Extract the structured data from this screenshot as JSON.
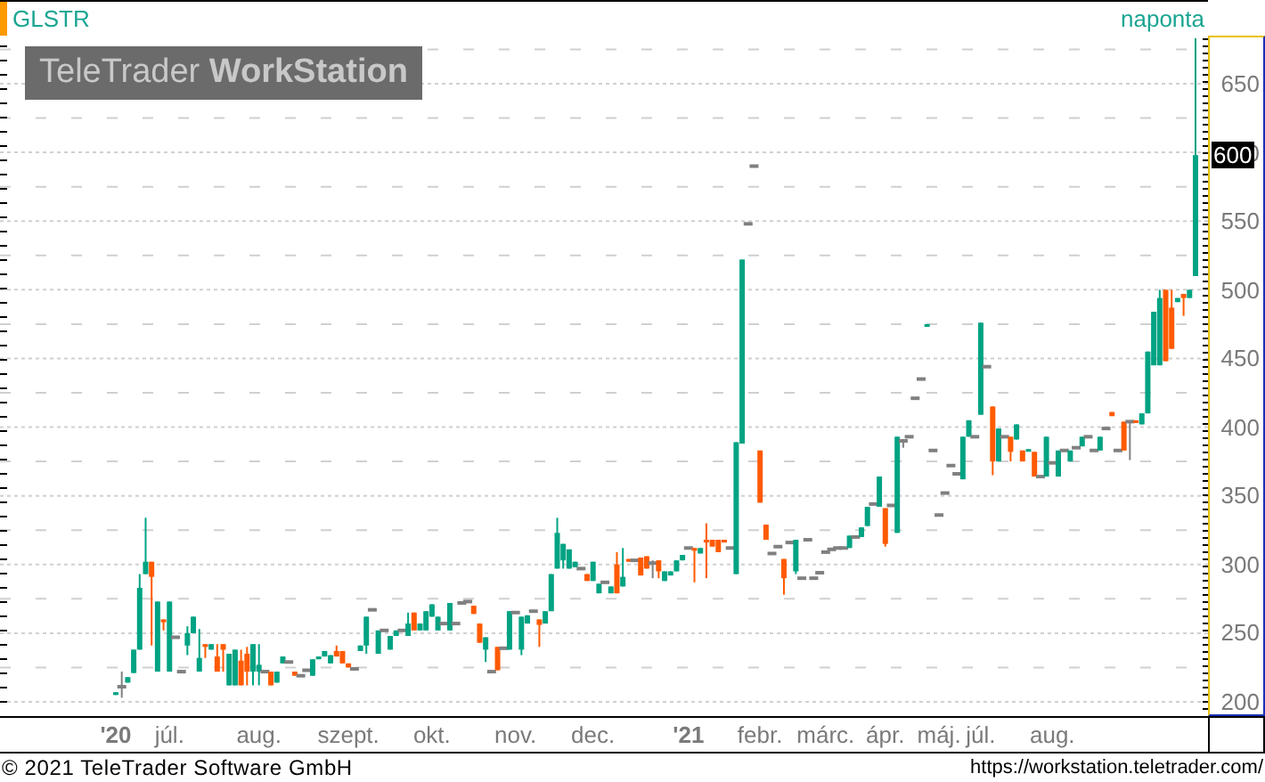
{
  "header": {
    "symbol": "GLSTR",
    "interval": "naponta"
  },
  "logo": "TeleTrader **WorkStation**",
  "price_marker": "600",
  "chart_data": {
    "type": "candlestick",
    "grid": true,
    "ylim": [
      200,
      650
    ],
    "yticks": [
      200,
      250,
      300,
      350,
      400,
      450,
      500,
      550,
      600,
      650
    ],
    "categories": [
      "'20",
      null,
      null,
      null,
      null,
      null,
      null,
      null,
      null,
      "júl.",
      null,
      null,
      null,
      null,
      null,
      null,
      null,
      null,
      null,
      null,
      null,
      null,
      null,
      null,
      "aug.",
      null,
      null,
      null,
      null,
      null,
      null,
      null,
      null,
      null,
      null,
      null,
      null,
      null,
      null,
      "szept.",
      null,
      null,
      null,
      null,
      null,
      null,
      null,
      null,
      null,
      null,
      null,
      null,
      null,
      "okt.",
      null,
      null,
      null,
      null,
      null,
      null,
      null,
      null,
      null,
      null,
      null,
      null,
      null,
      "nov.",
      null,
      null,
      null,
      null,
      null,
      null,
      null,
      null,
      null,
      null,
      null,
      null,
      "dec.",
      null,
      null,
      null,
      null,
      null,
      null,
      null,
      null,
      null,
      null,
      null,
      null,
      null,
      null,
      null,
      "'21",
      null,
      null,
      null,
      null,
      null,
      null,
      null,
      null,
      null,
      null,
      null,
      "febr.",
      null,
      null,
      null,
      null,
      null,
      null,
      null,
      null,
      null,
      null,
      "márc.",
      null,
      null,
      null,
      null,
      null,
      null,
      null,
      null,
      null,
      "ápr.",
      null,
      null,
      null,
      null,
      null,
      null,
      null,
      null,
      "máj.",
      null,
      null,
      null,
      null,
      null,
      null,
      "júl.",
      null,
      null,
      null,
      null,
      null,
      null,
      null,
      null,
      null,
      null,
      null,
      "aug.",
      null,
      null,
      null,
      null,
      null,
      null,
      null,
      null,
      null,
      null,
      null,
      null,
      null,
      null,
      null,
      null,
      null,
      null,
      null,
      null,
      null,
      null,
      null,
      null
    ],
    "ohlc": [
      [
        205,
        207,
        205,
        207
      ],
      [
        211,
        222,
        203,
        211
      ],
      [
        214,
        218,
        214,
        218
      ],
      [
        221,
        238,
        221,
        238
      ],
      [
        238,
        293,
        238,
        283
      ],
      [
        293,
        334,
        293,
        302
      ],
      [
        302,
        302,
        241,
        291
      ],
      [
        222,
        273,
        222,
        273
      ],
      [
        260,
        260,
        252,
        258
      ],
      [
        222,
        273,
        222,
        273
      ],
      [
        247,
        247,
        247,
        247
      ],
      [
        222,
        222,
        222,
        222
      ],
      [
        241,
        255,
        234,
        250
      ],
      [
        250,
        262,
        250,
        262
      ],
      [
        222,
        253,
        222,
        232
      ],
      [
        242,
        242,
        232,
        241
      ],
      [
        238,
        242,
        238,
        242
      ],
      [
        233,
        242,
        222,
        222
      ],
      [
        242,
        242,
        222,
        238
      ],
      [
        212,
        235,
        212,
        235
      ],
      [
        212,
        238,
        212,
        238
      ],
      [
        230,
        238,
        212,
        212
      ],
      [
        235,
        240,
        212,
        222
      ],
      [
        222,
        242,
        212,
        242
      ],
      [
        222,
        242,
        212,
        227
      ],
      [
        222,
        222,
        222,
        222
      ],
      [
        222,
        222,
        212,
        212
      ],
      [
        214,
        222,
        214,
        222
      ],
      [
        228,
        233,
        228,
        233
      ],
      [
        229,
        229,
        229,
        229
      ],
      [
        222,
        222,
        219,
        219
      ],
      [
        219,
        219,
        219,
        219
      ],
      [
        223,
        223,
        223,
        223
      ],
      [
        219,
        231,
        219,
        231
      ],
      [
        231,
        233,
        231,
        233
      ],
      [
        233,
        237,
        233,
        237
      ],
      [
        228,
        234,
        228,
        234
      ],
      [
        237,
        241,
        233,
        233
      ],
      [
        237,
        237,
        228,
        228
      ],
      [
        228,
        228,
        225,
        225
      ],
      [
        224,
        224,
        224,
        224
      ],
      [
        237,
        241,
        237,
        241
      ],
      [
        241,
        262,
        235,
        262
      ],
      [
        267,
        267,
        267,
        267
      ],
      [
        235,
        252,
        235,
        252
      ],
      [
        252,
        252,
        252,
        252
      ],
      [
        238,
        248,
        238,
        248
      ],
      [
        248,
        252,
        248,
        252
      ],
      [
        252,
        252,
        252,
        252
      ],
      [
        248,
        265,
        248,
        257
      ],
      [
        265,
        265,
        252,
        252
      ],
      [
        252,
        257,
        252,
        257
      ],
      [
        252,
        266,
        252,
        266
      ],
      [
        262,
        271,
        262,
        271
      ],
      [
        252,
        262,
        252,
        262
      ],
      [
        257,
        257,
        257,
        257
      ],
      [
        252,
        272,
        252,
        272
      ],
      [
        257,
        257,
        257,
        257
      ],
      [
        272,
        272,
        272,
        272
      ],
      [
        273,
        273,
        273,
        273
      ],
      [
        270,
        270,
        264,
        264
      ],
      [
        257,
        257,
        243,
        243
      ],
      [
        238,
        247,
        229,
        247
      ],
      [
        222,
        222,
        222,
        222
      ],
      [
        240,
        240,
        223,
        223
      ],
      [
        239,
        239,
        239,
        239
      ],
      [
        238,
        266,
        238,
        266
      ],
      [
        265,
        265,
        265,
        265
      ],
      [
        238,
        262,
        234,
        262
      ],
      [
        257,
        263,
        257,
        263
      ],
      [
        266,
        266,
        266,
        266
      ],
      [
        260,
        260,
        240,
        256
      ],
      [
        257,
        266,
        257,
        266
      ],
      [
        266,
        293,
        266,
        293
      ],
      [
        297,
        334,
        297,
        323
      ],
      [
        303,
        315,
        297,
        315
      ],
      [
        297,
        311,
        297,
        311
      ],
      [
        298,
        302,
        298,
        302
      ],
      [
        297,
        297,
        297,
        297
      ],
      [
        293,
        293,
        288,
        288
      ],
      [
        288,
        302,
        288,
        302
      ],
      [
        279,
        286,
        279,
        286
      ],
      [
        287,
        287,
        287,
        287
      ],
      [
        279,
        284,
        279,
        284
      ],
      [
        300,
        309,
        279,
        279
      ],
      [
        284,
        312,
        284,
        291
      ],
      [
        304,
        304,
        302,
        302
      ],
      [
        303,
        303,
        303,
        303
      ],
      [
        305,
        305,
        292,
        292
      ],
      [
        306,
        306,
        297,
        297
      ],
      [
        301,
        303,
        290,
        301
      ],
      [
        303,
        303,
        290,
        295
      ],
      [
        288,
        295,
        288,
        295
      ],
      [
        292,
        295,
        292,
        295
      ],
      [
        295,
        303,
        295,
        303
      ],
      [
        303,
        307,
        303,
        307
      ],
      [
        312,
        312,
        312,
        312
      ],
      [
        312,
        312,
        287,
        310
      ],
      [
        308,
        312,
        308,
        312
      ],
      [
        318,
        330,
        290,
        316
      ],
      [
        318,
        318,
        313,
        313
      ],
      [
        318,
        318,
        309,
        309
      ],
      [
        318,
        318,
        316,
        316
      ],
      [
        312,
        312,
        312,
        312
      ],
      [
        293,
        389,
        293,
        389
      ],
      [
        388,
        522,
        388,
        522
      ],
      [
        548,
        548,
        548,
        548
      ],
      [
        590,
        590,
        590,
        590
      ],
      [
        383,
        383,
        345,
        345
      ],
      [
        329,
        329,
        318,
        318
      ],
      [
        308,
        308,
        308,
        308
      ],
      [
        313,
        313,
        313,
        313
      ],
      [
        304,
        304,
        278,
        290
      ],
      [
        316,
        316,
        316,
        316
      ],
      [
        295,
        318,
        293,
        318
      ],
      [
        290,
        290,
        290,
        290
      ],
      [
        318,
        318,
        318,
        318
      ],
      [
        290,
        290,
        290,
        290
      ],
      [
        294,
        294,
        294,
        294
      ],
      [
        309,
        309,
        309,
        309
      ],
      [
        311,
        311,
        311,
        311
      ],
      [
        312,
        312,
        312,
        312
      ],
      [
        312,
        312,
        312,
        312
      ],
      [
        312,
        321,
        312,
        321
      ],
      [
        320,
        320,
        320,
        320
      ],
      [
        320,
        327,
        320,
        327
      ],
      [
        328,
        342,
        328,
        342
      ],
      [
        344,
        344,
        344,
        344
      ],
      [
        342,
        364,
        342,
        364
      ],
      [
        341,
        341,
        313,
        315
      ],
      [
        343,
        343,
        343,
        343
      ],
      [
        323,
        393,
        323,
        393
      ],
      [
        390,
        390,
        385,
        390
      ],
      [
        393,
        393,
        393,
        393
      ],
      [
        421,
        421,
        421,
        421
      ],
      [
        435,
        435,
        435,
        435
      ],
      [
        473,
        475,
        473,
        475
      ],
      [
        383,
        383,
        383,
        383
      ],
      [
        336,
        336,
        336,
        336
      ],
      [
        352,
        352,
        352,
        352
      ],
      [
        372,
        372,
        372,
        372
      ],
      [
        366,
        366,
        366,
        366
      ],
      [
        362,
        393,
        362,
        393
      ],
      [
        393,
        405,
        393,
        405
      ],
      [
        393,
        393,
        393,
        393
      ],
      [
        409,
        476,
        409,
        476
      ],
      [
        444,
        444,
        444,
        444
      ],
      [
        415,
        415,
        365,
        375
      ],
      [
        375,
        399,
        375,
        399
      ],
      [
        393,
        393,
        393,
        393
      ],
      [
        393,
        393,
        375,
        382
      ],
      [
        391,
        402,
        391,
        402
      ],
      [
        383,
        383,
        375,
        375
      ],
      [
        383,
        384,
        383,
        384
      ],
      [
        382,
        382,
        364,
        364
      ],
      [
        364,
        364,
        364,
        364
      ],
      [
        364,
        393,
        364,
        393
      ],
      [
        374,
        374,
        374,
        374
      ],
      [
        364,
        383,
        364,
        383
      ],
      [
        383,
        383,
        383,
        383
      ],
      [
        375,
        383,
        375,
        383
      ],
      [
        385,
        385,
        385,
        385
      ],
      [
        386,
        393,
        386,
        393
      ],
      [
        393,
        393,
        393,
        393
      ],
      [
        383,
        383,
        383,
        383
      ],
      [
        383,
        393,
        383,
        393
      ],
      [
        399,
        399,
        399,
        399
      ],
      [
        411,
        411,
        408,
        408
      ],
      [
        383,
        383,
        383,
        383
      ],
      [
        404,
        404,
        383,
        383
      ],
      [
        404,
        404,
        376,
        404
      ],
      [
        405,
        405,
        403,
        403
      ],
      [
        402,
        410,
        402,
        410
      ],
      [
        410,
        455,
        410,
        455
      ],
      [
        445,
        484,
        445,
        484
      ],
      [
        445,
        500,
        445,
        494
      ],
      [
        500,
        500,
        448,
        448
      ],
      [
        487,
        500,
        457,
        457
      ],
      [
        491,
        494,
        491,
        494
      ],
      [
        497,
        497,
        481,
        494
      ],
      [
        494,
        500,
        494,
        500
      ],
      [
        510,
        683,
        510,
        598
      ]
    ]
  },
  "footer": {
    "copyright": "© 2021 TeleTrader Software GmbH",
    "url": "https://workstation.teletrader.com/"
  }
}
